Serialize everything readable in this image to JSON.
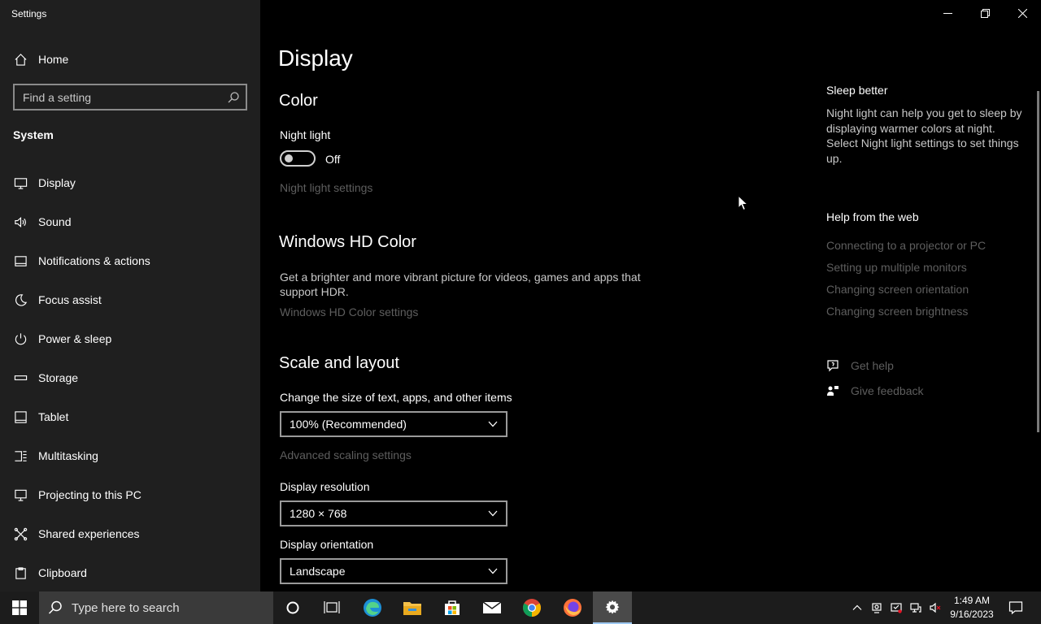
{
  "window": {
    "app_title": "Settings"
  },
  "sidebar": {
    "home_label": "Home",
    "search_placeholder": "Find a setting",
    "section_label": "System",
    "items": [
      {
        "label": "Display",
        "icon": "monitor-icon"
      },
      {
        "label": "Sound",
        "icon": "speaker-icon"
      },
      {
        "label": "Notifications & actions",
        "icon": "notification-icon"
      },
      {
        "label": "Focus assist",
        "icon": "moon-icon"
      },
      {
        "label": "Power & sleep",
        "icon": "power-icon"
      },
      {
        "label": "Storage",
        "icon": "storage-icon"
      },
      {
        "label": "Tablet",
        "icon": "tablet-icon"
      },
      {
        "label": "Multitasking",
        "icon": "multitasking-icon"
      },
      {
        "label": "Projecting to this PC",
        "icon": "projector-icon"
      },
      {
        "label": "Shared experiences",
        "icon": "shared-icon"
      },
      {
        "label": "Clipboard",
        "icon": "clipboard-icon"
      }
    ]
  },
  "main": {
    "page_title": "Display",
    "color": {
      "heading": "Color",
      "night_light_label": "Night light",
      "night_light_state": "Off",
      "night_light_settings": "Night light settings"
    },
    "hd_color": {
      "heading": "Windows HD Color",
      "description": "Get a brighter and more vibrant picture for videos, games and apps that support HDR.",
      "settings_link": "Windows HD Color settings"
    },
    "scale_layout": {
      "heading": "Scale and layout",
      "size_label": "Change the size of text, apps, and other items",
      "size_value": "100% (Recommended)",
      "advanced_link": "Advanced scaling settings",
      "resolution_label": "Display resolution",
      "resolution_value": "1280 × 768",
      "orientation_label": "Display orientation",
      "orientation_value": "Landscape"
    }
  },
  "right_column": {
    "sleep_heading": "Sleep better",
    "sleep_text": "Night light can help you get to sleep by displaying warmer colors at night. Select Night light settings to set things up.",
    "help_heading": "Help from the web",
    "help_links": [
      "Connecting to a projector or PC",
      "Setting up multiple monitors",
      "Changing screen orientation",
      "Changing screen brightness"
    ],
    "get_help": "Get help",
    "give_feedback": "Give feedback"
  },
  "taskbar": {
    "search_placeholder": "Type here to search",
    "clock_time": "1:49 AM",
    "clock_date": "9/16/2023",
    "apps": [
      "cortana-icon",
      "task-view-icon",
      "edge-icon",
      "file-explorer-icon",
      "store-icon",
      "mail-icon",
      "chrome-icon",
      "firefox-icon",
      "settings-icon"
    ]
  },
  "colors": {
    "sidebar_bg": "#1f1f1f",
    "main_bg": "#000000",
    "taskbar_bg": "#1c1c1c",
    "disabled_link": "#5e5e5e",
    "accent": "#9ec9f2"
  }
}
